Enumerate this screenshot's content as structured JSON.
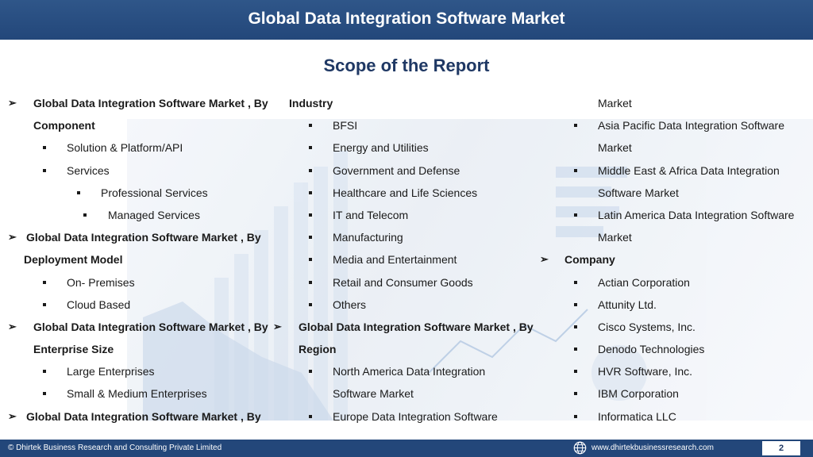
{
  "header": {
    "title": "Global Data Integration Software Market"
  },
  "subtitle": "Scope of the Report",
  "col1": {
    "l1a": "Global Data Integration Software Market , By",
    "l1b": "Component",
    "l1c": "Solution & Platform/API",
    "l1d": "Services",
    "l1e": "Professional Services",
    "l1f": "Managed Services",
    "l1g": "Global Data Integration Software Market , By",
    "l1h": "Deployment Model",
    "l1i": "On- Premises",
    "l1j": "Cloud Based",
    "l1k": "Global Data Integration Software Market , By",
    "l1l": "Enterprise Size",
    "l1m": "Large Enterprises",
    "l1n": "Small & Medium Enterprises",
    "l1o": "Global Data Integration Software Market , By"
  },
  "col2": {
    "l2a": "Industry",
    "l2b": "BFSI",
    "l2c": "Energy and Utilities",
    "l2d": "Government and Defense",
    "l2e": "Healthcare and Life Sciences",
    "l2f": "IT and Telecom",
    "l2g": "Manufacturing",
    "l2h": "Media and Entertainment",
    "l2i": "Retail and Consumer Goods",
    "l2j": "Others",
    "l2k": "Global Data Integration Software Market , By",
    "l2l": "Region",
    "l2m": "North America Data Integration",
    "l2n": "Software Market",
    "l2o": "Europe Data Integration Software"
  },
  "col3": {
    "l3a": "Market",
    "l3b": "Asia Pacific Data Integration Software",
    "l3c": "Market",
    "l3d": "Middle East & Africa Data Integration",
    "l3e": "Software Market",
    "l3f": "Latin America Data Integration Software",
    "l3g": "Market",
    "l3h": "Company",
    "l3i": "Actian Corporation",
    "l3j": "Attunity Ltd.",
    "l3k": "Cisco Systems, Inc.",
    "l3l": "Denodo Technologies",
    "l3m": "HVR Software, Inc.",
    "l3n": "IBM Corporation",
    "l3o": "Informatica LLC"
  },
  "footer": {
    "copyright": "© Dhirtek Business Research and Consulting Private Limited",
    "website": "www.dhirtekbusinessresearch.com",
    "page": "2"
  },
  "colors": {
    "header_bg": "#2f5689",
    "footer_bg": "#23477a",
    "subtitle": "#1f3864"
  },
  "icons": {
    "bullet_arrow": "arrow-bullet-icon",
    "bullet_square": "square-bullet-icon",
    "footer_globe": "globe-icon"
  }
}
